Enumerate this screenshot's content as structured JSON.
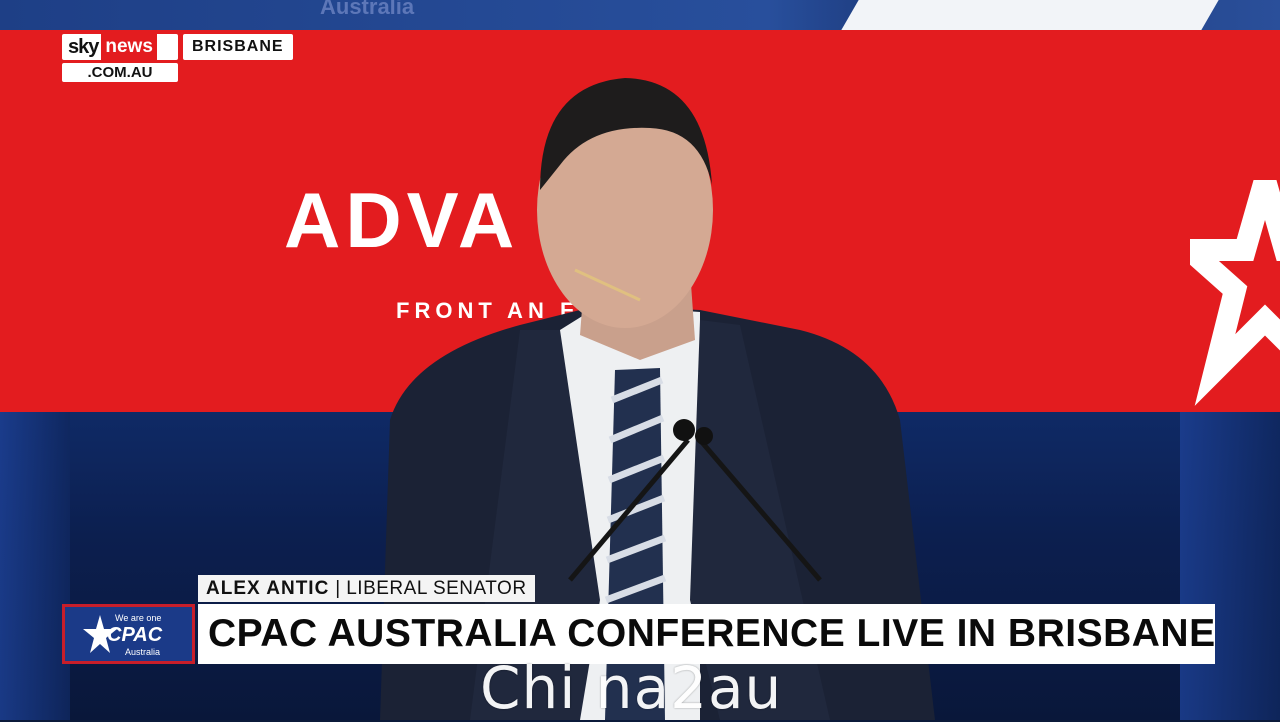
{
  "broadcast": {
    "channel_logo": {
      "line1_sky": "sky",
      "line1_news": "news",
      "line2": ".COM.AU"
    },
    "location": "BRISBANE",
    "lower_third": {
      "speaker_name": "ALEX ANTIC",
      "separator": "|",
      "speaker_title": "LIBERAL SENATOR",
      "headline": "CPAC AUSTRALIA CONFERENCE LIVE IN BRISBANE"
    },
    "badge": {
      "top": "We are one",
      "main": "CPAC",
      "bottom": "Australia"
    }
  },
  "backdrop": {
    "screen_title": "ADVA CE",
    "screen_subtitle": "FRONT AN E",
    "top_band_text": "Australia"
  },
  "watermark": "Chi na2au",
  "colors": {
    "brand_red": "#e31c1f",
    "badge_blue": "#1b3a88",
    "backdrop_red": "#e31c1f"
  }
}
